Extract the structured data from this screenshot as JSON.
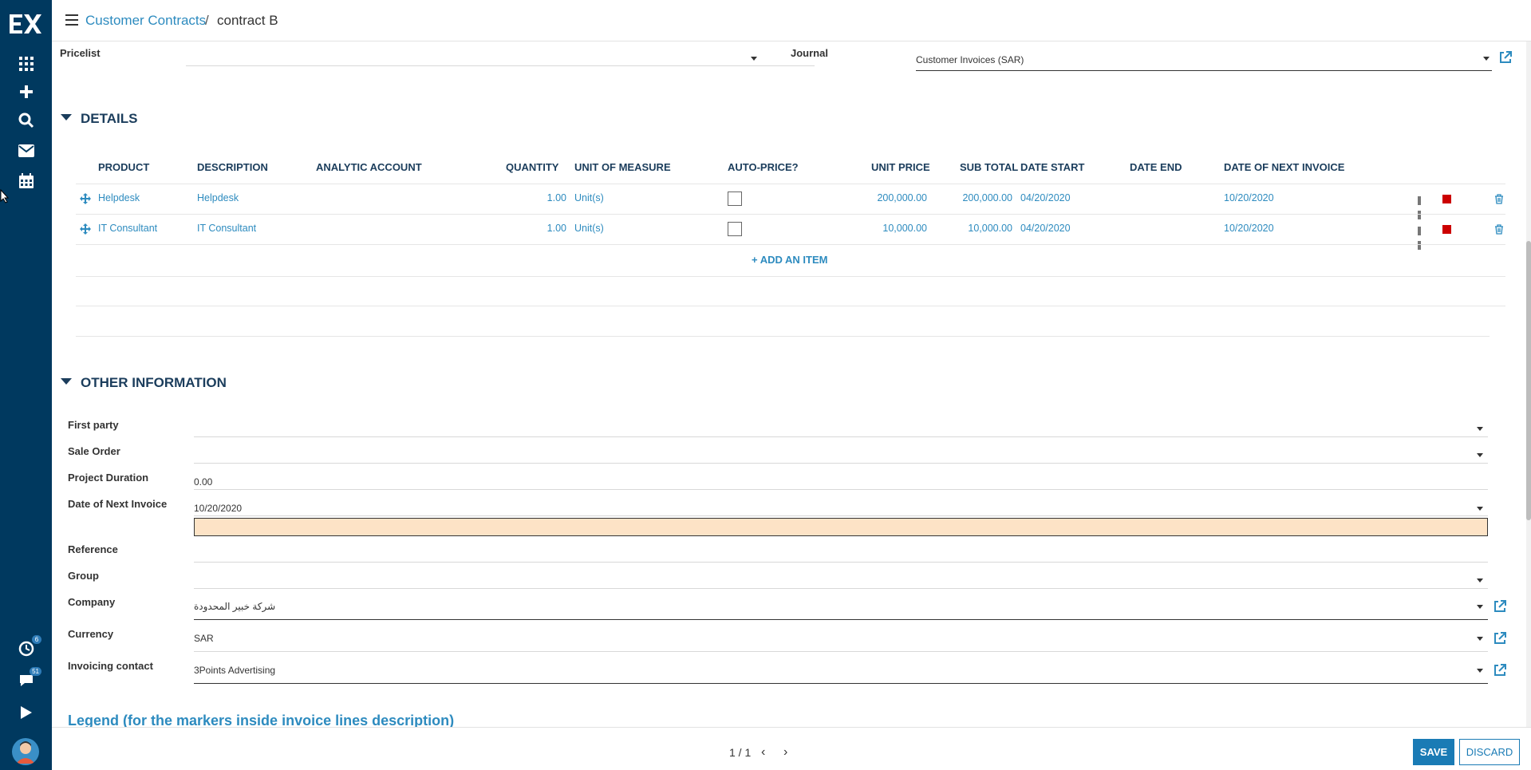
{
  "breadcrumb": {
    "parent": "Customer Contracts",
    "separator": "/",
    "current": "contract B"
  },
  "top_fields": {
    "pricelist_label": "Pricelist",
    "pricelist_value": "",
    "journal_label": "Journal",
    "journal_value": "Customer Invoices (SAR)"
  },
  "details": {
    "title": "DETAILS",
    "columns": [
      "PRODUCT",
      "DESCRIPTION",
      "ANALYTIC ACCOUNT",
      "QUANTITY",
      "UNIT OF MEASURE",
      "AUTO-PRICE?",
      "UNIT PRICE",
      "SUB TOTAL",
      "DATE START",
      "DATE END",
      "DATE OF NEXT INVOICE"
    ],
    "rows": [
      {
        "product": "Helpdesk",
        "description": "Helpdesk",
        "analytic": "",
        "quantity": "1.00",
        "uom": "Unit(s)",
        "auto_price": false,
        "unit_price": "200,000.00",
        "sub_total": "200,000.00",
        "date_start": "04/20/2020",
        "date_end": "",
        "next_invoice": "10/20/2020"
      },
      {
        "product": "IT Consultant",
        "description": "IT Consultant",
        "analytic": "",
        "quantity": "1.00",
        "uom": "Unit(s)",
        "auto_price": false,
        "unit_price": "10,000.00",
        "sub_total": "10,000.00",
        "date_start": "04/20/2020",
        "date_end": "",
        "next_invoice": "10/20/2020"
      }
    ],
    "add_item": "ADD AN ITEM"
  },
  "other": {
    "title": "OTHER INFORMATION",
    "first_party_label": "First party",
    "first_party_value": "",
    "sale_order_label": "Sale Order",
    "sale_order_value": "",
    "project_duration_label": "Project Duration",
    "project_duration_value": "0.00",
    "next_invoice_label": "Date of Next Invoice",
    "next_invoice_value": "10/20/2020",
    "reference_label": "Reference",
    "reference_value": "",
    "group_label": "Group",
    "group_value": "",
    "company_label": "Company",
    "company_value": "شركة خبير المحدودة",
    "currency_label": "Currency",
    "currency_value": "SAR",
    "invoicing_contact_label": "Invoicing contact",
    "invoicing_contact_value": "3Points Advertising"
  },
  "legend_title": "Legend (for the markers inside invoice lines description)",
  "pager": {
    "text": "1 / 1"
  },
  "buttons": {
    "save": "SAVE",
    "discard": "DISCARD"
  },
  "sidebar": {
    "badges": {
      "activity": "6",
      "messages": "51"
    },
    "icons": [
      "apps-icon",
      "plus-icon",
      "search-icon",
      "mail-icon",
      "calendar-icon",
      "activity-icon",
      "chat-icon",
      "play-icon"
    ]
  },
  "colors": {
    "sidebar": "#00395f",
    "link": "#2d8bbf",
    "accent": "#1a7bb5",
    "heading": "#1b3d5c",
    "highlight": "#fde3c6",
    "stop": "#cc0000"
  }
}
